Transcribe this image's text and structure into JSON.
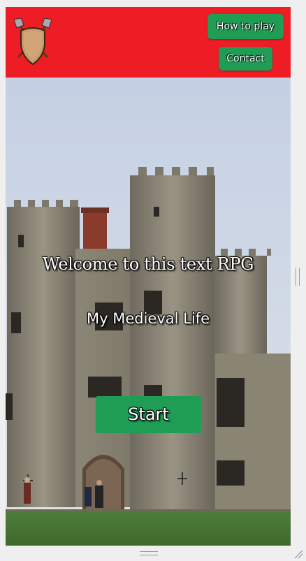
{
  "header": {
    "logo_icon": "shield-with-crossed-axes-icon",
    "background_color": "#ee1c25",
    "nav": {
      "how_to_play_label": "How to play",
      "contact_label": "Contact"
    },
    "button_color": "#1f9d55"
  },
  "hero": {
    "background": "castle-photo",
    "welcome_text": "Welcome to this text RPG",
    "game_title": "My Medieval Life",
    "start_label": "Start"
  }
}
